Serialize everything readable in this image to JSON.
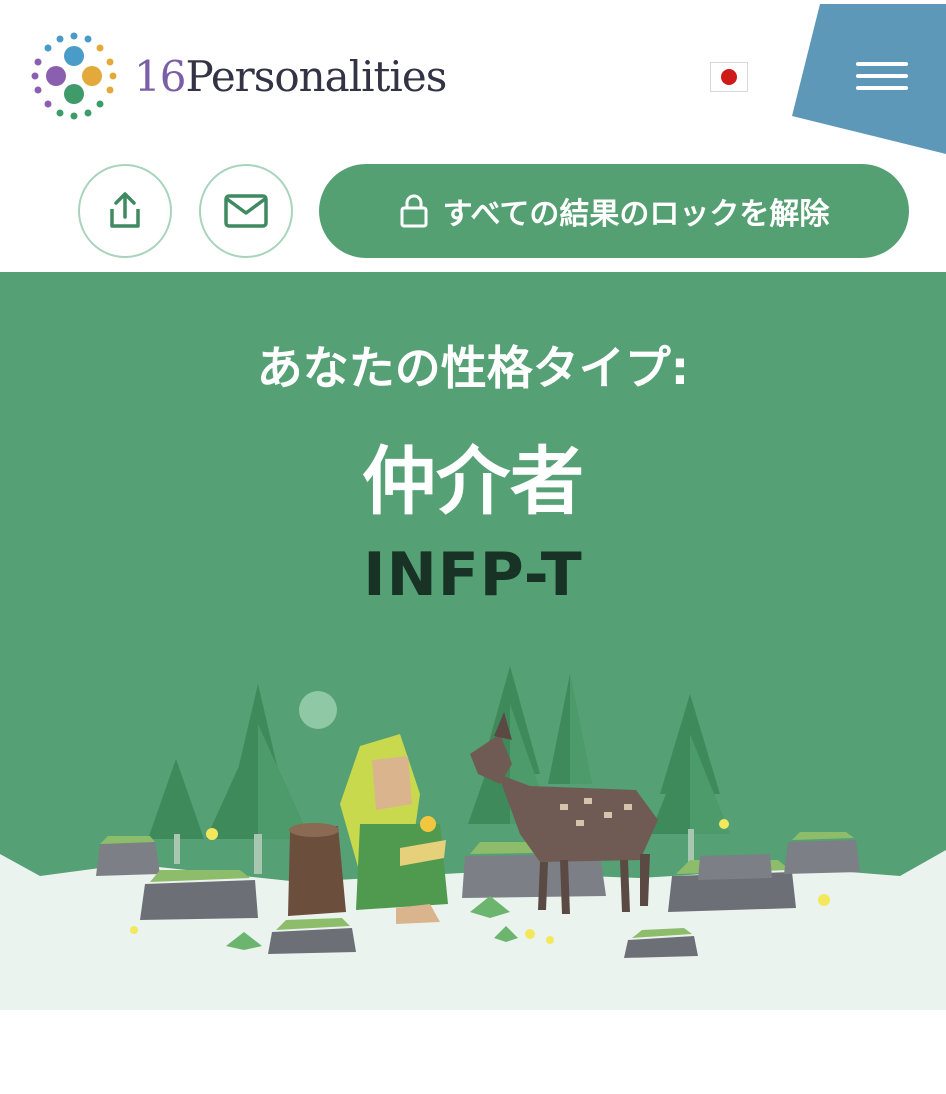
{
  "header": {
    "brand_number": "16",
    "brand_name": "Personalities",
    "language_flag": "japan-flag-icon",
    "menu_icon": "hamburger-menu-icon"
  },
  "actions": {
    "share_icon": "share-icon",
    "email_icon": "mail-icon",
    "unlock_icon": "lock-icon",
    "unlock_label": "すべての結果のロックを解除"
  },
  "hero": {
    "subtitle": "あなたの性格タイプ:",
    "title": "仲介者",
    "code": "INFP-T"
  },
  "colors": {
    "brand_green": "#55a073",
    "hero_green": "#55a074",
    "menu_blue": "#5d98b8",
    "code_dark": "#183325"
  }
}
